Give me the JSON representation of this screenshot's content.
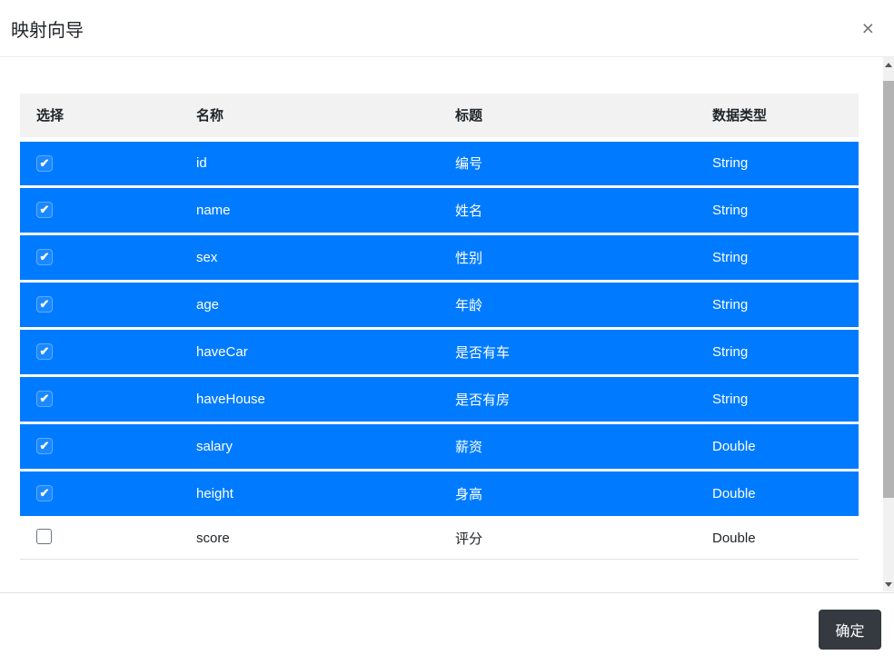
{
  "dialog": {
    "title": "映射向导",
    "close_icon": "×"
  },
  "table": {
    "headers": {
      "select": "选择",
      "name": "名称",
      "caption": "标题",
      "type": "数据类型"
    },
    "rows": [
      {
        "checked": true,
        "name": "id",
        "caption": "编号",
        "type": "String"
      },
      {
        "checked": true,
        "name": "name",
        "caption": "姓名",
        "type": "String"
      },
      {
        "checked": true,
        "name": "sex",
        "caption": "性别",
        "type": "String"
      },
      {
        "checked": true,
        "name": "age",
        "caption": "年龄",
        "type": "String"
      },
      {
        "checked": true,
        "name": "haveCar",
        "caption": "是否有车",
        "type": "String"
      },
      {
        "checked": true,
        "name": "haveHouse",
        "caption": "是否有房",
        "type": "String"
      },
      {
        "checked": true,
        "name": "salary",
        "caption": "薪资",
        "type": "Double"
      },
      {
        "checked": true,
        "name": "height",
        "caption": "身高",
        "type": "Double"
      },
      {
        "checked": false,
        "name": "score",
        "caption": "评分",
        "type": "Double"
      }
    ]
  },
  "icons": {
    "check": "✔"
  },
  "footer": {
    "ok_label": "确定"
  },
  "colors": {
    "selected_row": "#007bff",
    "header_bg": "#f2f2f2",
    "ok_button_bg": "#343a40",
    "text_dark": "#212529"
  }
}
